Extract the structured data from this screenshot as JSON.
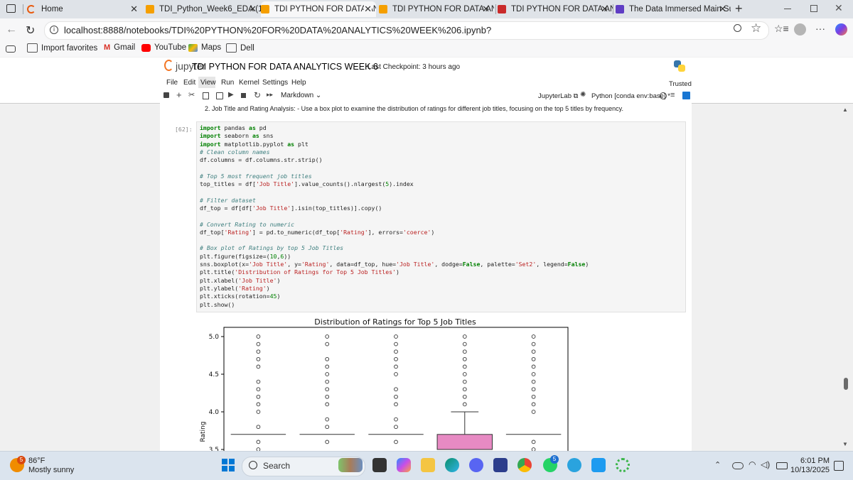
{
  "browser": {
    "tabs": [
      {
        "label": "Home",
        "color": "#e8590c"
      },
      {
        "label": "TDI_Python_Week6_EDA (1)",
        "color": "#f59f00"
      },
      {
        "label": "TDI PYTHON FOR DATA ANA",
        "color": "#f59f00"
      },
      {
        "label": "TDI PYTHON FOR DATA ANA",
        "color": "#f59f00"
      },
      {
        "label": "TDI PYTHON FOR DATA ANA",
        "color": "#c92a2a"
      },
      {
        "label": "The Data Immersed Main Su",
        "color": "#5f3dc4"
      }
    ],
    "url": "localhost:8888/notebooks/TDI%20PYTHON%20FOR%20DATA%20ANALYTICS%20WEEK%206.ipynb?",
    "bookmarks": [
      "Import favorites",
      "Gmail",
      "YouTube",
      "Maps",
      "Dell"
    ]
  },
  "jupyter": {
    "logo_text": "jupyter",
    "notebook_title": "TDI PYTHON FOR DATA ANALYTICS WEEK 6",
    "checkpoint": "Last Checkpoint: 3 hours ago",
    "menu": [
      "File",
      "Edit",
      "View",
      "Run",
      "Kernel",
      "Settings",
      "Help"
    ],
    "trusted": "Trusted",
    "cell_type": "Markdown",
    "jupyterlab_link": "JupyterLab",
    "kernel": "Python [conda env:base] *",
    "markdown_text": "2. Job Title and Rating Analysis: - Use a box plot to examine the distribution of ratings for different job titles, focusing on the top 5 titles by frequency.",
    "cell_prompt": "[62]:"
  },
  "chart_data": {
    "type": "box",
    "title": "Distribution of Ratings for Top 5 Job Titles",
    "xlabel": "",
    "ylabel": "Rating",
    "yticks": [
      "5.0",
      "4.5",
      "4.0",
      "3.5"
    ],
    "categories_count": 5,
    "colors": [
      "#66c2a5",
      "#fc8d62",
      "#8da0cb",
      "#e78ac3",
      "#a6d854"
    ],
    "series": [
      {
        "median": 3.7,
        "q1": 3.7,
        "q3": 3.7,
        "whisker_high": 3.7,
        "outliers": [
          5.0,
          4.9,
          4.8,
          4.7,
          4.6,
          4.4,
          4.3,
          4.2,
          4.1,
          4.0,
          3.8,
          3.6,
          3.5
        ]
      },
      {
        "median": 3.7,
        "q1": 3.7,
        "q3": 3.7,
        "whisker_high": 3.7,
        "outliers": [
          5.0,
          4.9,
          4.7,
          4.6,
          4.5,
          4.4,
          4.3,
          4.2,
          4.1,
          3.9,
          3.8,
          3.6
        ]
      },
      {
        "median": 3.7,
        "q1": 3.7,
        "q3": 3.7,
        "whisker_high": 3.7,
        "outliers": [
          5.0,
          4.9,
          4.8,
          4.7,
          4.6,
          4.5,
          4.3,
          4.2,
          4.1,
          3.9,
          3.8,
          3.6
        ]
      },
      {
        "median": 3.5,
        "q1": 3.5,
        "q3": 3.7,
        "whisker_high": 4.0,
        "outliers": [
          5.0,
          4.9,
          4.8,
          4.7,
          4.6,
          4.5,
          4.4,
          4.3,
          4.2,
          4.1
        ]
      },
      {
        "median": 3.7,
        "q1": 3.7,
        "q3": 3.7,
        "whisker_high": 3.7,
        "outliers": [
          5.0,
          4.9,
          4.8,
          4.7,
          4.6,
          4.5,
          4.4,
          4.3,
          4.2,
          4.1,
          4.0,
          3.6,
          3.5
        ]
      }
    ]
  },
  "taskbar": {
    "temperature": "86°F",
    "weather": "Mostly sunny",
    "weather_badge": "5",
    "search_placeholder": "Search",
    "time": "6:01 PM",
    "date": "10/13/2025",
    "whatsapp_badge": "5"
  }
}
